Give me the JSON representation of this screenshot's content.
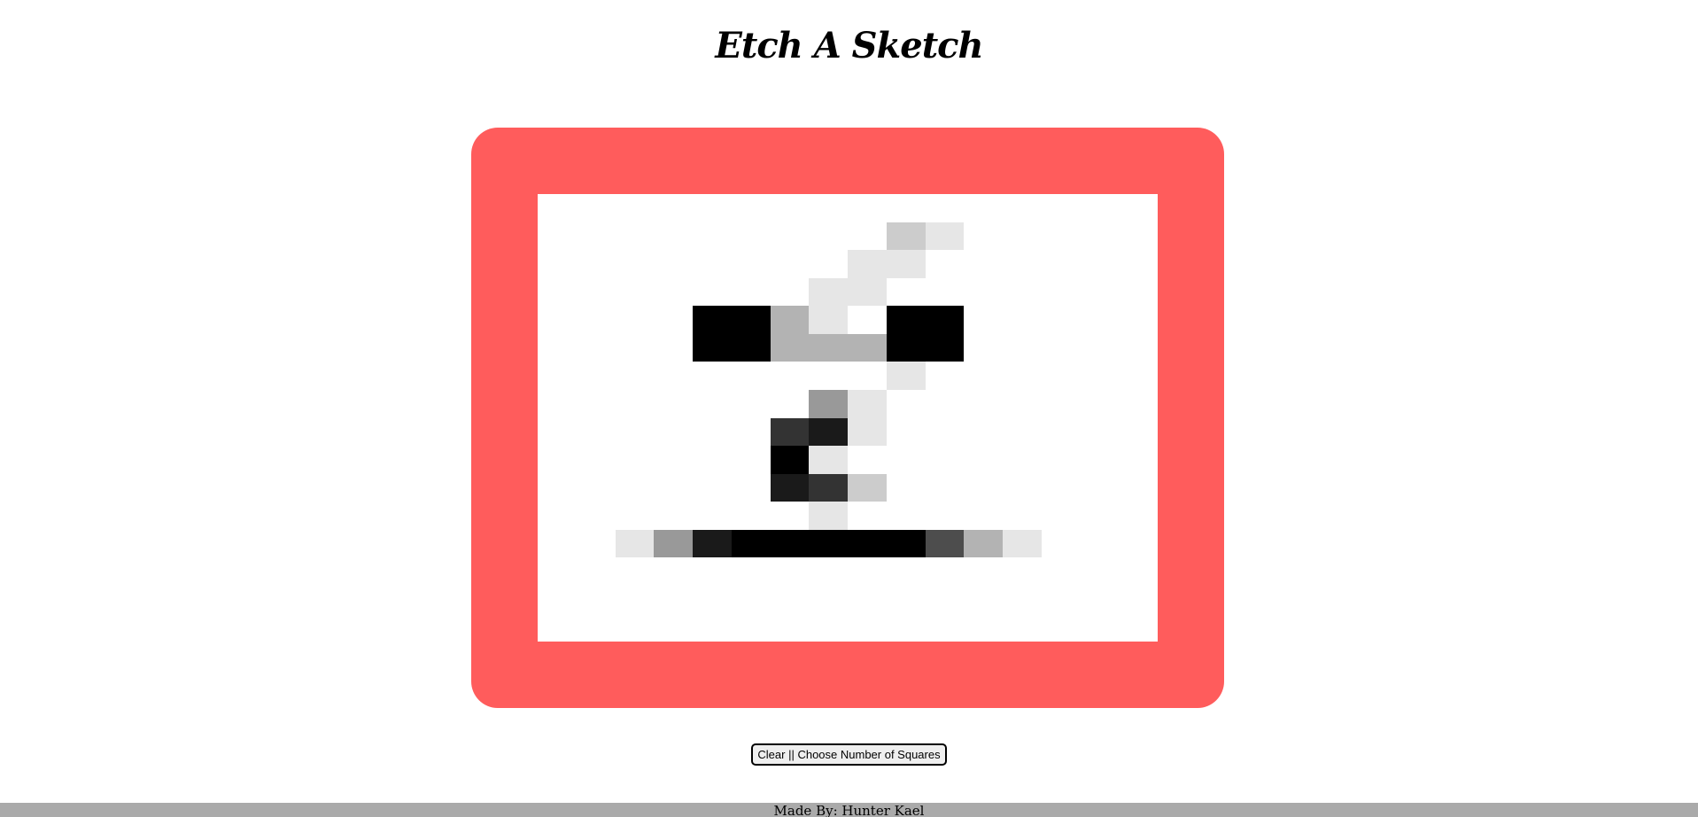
{
  "header": {
    "title": "Etch A Sketch"
  },
  "board": {
    "frame_color": "#ff5c5c",
    "grid_size": 16,
    "cells": [
      {
        "row": 1,
        "col": 9,
        "color": "#cccccc"
      },
      {
        "row": 1,
        "col": 10,
        "color": "#e6e6e6"
      },
      {
        "row": 2,
        "col": 8,
        "color": "#e6e6e6"
      },
      {
        "row": 2,
        "col": 9,
        "color": "#e6e6e6"
      },
      {
        "row": 3,
        "col": 7,
        "color": "#e6e6e6"
      },
      {
        "row": 3,
        "col": 8,
        "color": "#e6e6e6"
      },
      {
        "row": 4,
        "col": 4,
        "color": "#000000"
      },
      {
        "row": 4,
        "col": 5,
        "color": "#000000"
      },
      {
        "row": 4,
        "col": 6,
        "color": "#b3b3b3"
      },
      {
        "row": 4,
        "col": 7,
        "color": "#e6e6e6"
      },
      {
        "row": 4,
        "col": 9,
        "color": "#000000"
      },
      {
        "row": 4,
        "col": 10,
        "color": "#000000"
      },
      {
        "row": 5,
        "col": 4,
        "color": "#000000"
      },
      {
        "row": 5,
        "col": 5,
        "color": "#000000"
      },
      {
        "row": 5,
        "col": 6,
        "color": "#b3b3b3"
      },
      {
        "row": 5,
        "col": 7,
        "color": "#b3b3b3"
      },
      {
        "row": 5,
        "col": 8,
        "color": "#b3b3b3"
      },
      {
        "row": 5,
        "col": 9,
        "color": "#000000"
      },
      {
        "row": 5,
        "col": 10,
        "color": "#000000"
      },
      {
        "row": 6,
        "col": 9,
        "color": "#e6e6e6"
      },
      {
        "row": 7,
        "col": 7,
        "color": "#999999"
      },
      {
        "row": 7,
        "col": 8,
        "color": "#e6e6e6"
      },
      {
        "row": 8,
        "col": 6,
        "color": "#333333"
      },
      {
        "row": 8,
        "col": 7,
        "color": "#1a1a1a"
      },
      {
        "row": 8,
        "col": 8,
        "color": "#e6e6e6"
      },
      {
        "row": 9,
        "col": 6,
        "color": "#000000"
      },
      {
        "row": 9,
        "col": 7,
        "color": "#e6e6e6"
      },
      {
        "row": 10,
        "col": 6,
        "color": "#1a1a1a"
      },
      {
        "row": 10,
        "col": 7,
        "color": "#333333"
      },
      {
        "row": 10,
        "col": 8,
        "color": "#cccccc"
      },
      {
        "row": 11,
        "col": 7,
        "color": "#e6e6e6"
      },
      {
        "row": 12,
        "col": 2,
        "color": "#e6e6e6"
      },
      {
        "row": 12,
        "col": 3,
        "color": "#999999"
      },
      {
        "row": 12,
        "col": 4,
        "color": "#1a1a1a"
      },
      {
        "row": 12,
        "col": 5,
        "color": "#000000"
      },
      {
        "row": 12,
        "col": 6,
        "color": "#000000"
      },
      {
        "row": 12,
        "col": 7,
        "color": "#000000"
      },
      {
        "row": 12,
        "col": 8,
        "color": "#000000"
      },
      {
        "row": 12,
        "col": 9,
        "color": "#000000"
      },
      {
        "row": 12,
        "col": 10,
        "color": "#4d4d4d"
      },
      {
        "row": 12,
        "col": 11,
        "color": "#b3b3b3"
      },
      {
        "row": 12,
        "col": 12,
        "color": "#e6e6e6"
      }
    ]
  },
  "controls": {
    "clear_label": "Clear || Choose Number of Squares"
  },
  "footer": {
    "credit": "Made By: Hunter Kael"
  }
}
